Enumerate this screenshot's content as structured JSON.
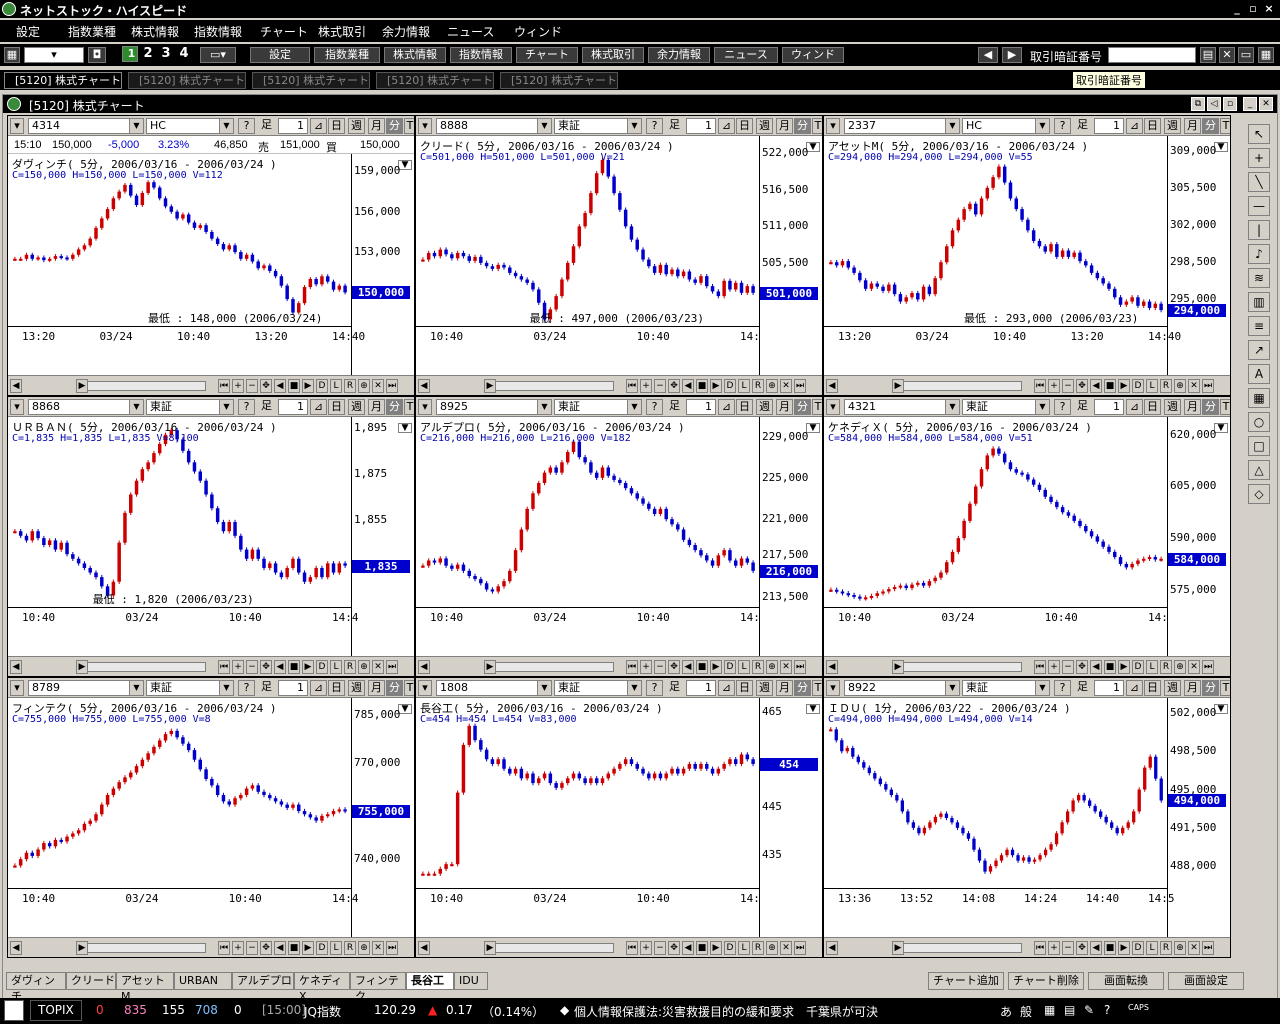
{
  "app": {
    "title": "ネットストック・ハイスピード",
    "win_controls": [
      "_",
      "▫",
      "×"
    ]
  },
  "menu": [
    "設定",
    "指数業種",
    "株式情報",
    "指数情報",
    "チャート",
    "株式取引",
    "余力情報",
    "ニュース",
    "ウィンド"
  ],
  "toolbar": {
    "layouts": [
      "1",
      "2",
      "3",
      "4"
    ],
    "buttons": [
      "設定",
      "指数業種",
      "株式情報",
      "指数情報",
      "チャート",
      "株式取引",
      "余力情報",
      "ニュース",
      "ウィンド"
    ],
    "pin_label": "取引暗証番号",
    "tooltip": "取引暗証番号"
  },
  "window_tabs": [
    "[5120] 株式チャート",
    "[5120] 株式チャート",
    "[5120] 株式チャート",
    "[5120] 株式チャート",
    "[5120] 株式チャート"
  ],
  "mdi_title": "[5120] 株式チャート",
  "interval_buttons": [
    "足",
    "日",
    "週",
    "月",
    "分",
    "T"
  ],
  "quote_row": {
    "time": "15:10",
    "price": "150,000",
    "change": "-5,000",
    "pct": "3.23%",
    "volume": "46,850",
    "sell_label": "売",
    "sell": "151,000",
    "buy_label": "買",
    "buy": "150,000"
  },
  "colors": {
    "up": "#cc0000",
    "down": "#0000cc",
    "tag": "#0000cc"
  },
  "panels": [
    {
      "code": "4314",
      "market": "HC",
      "title": "ダヴィンチ( 5分, 2006/03/16 - 2006/03/24 )",
      "ohlc": "C=150,000  H=150,000  L=150,000  V=112",
      "yticks": [
        "159,000",
        "156,000",
        "153,000"
      ],
      "ymin": 147500,
      "ymax": 160000,
      "tag": "150,000",
      "tag_value": 150000,
      "xticks": [
        "13:20",
        "03/24",
        "10:40",
        "13:20",
        "14:40"
      ],
      "low_label": "最低 : 148,000 (2006/03/24)",
      "series": [
        152500,
        152500,
        152800,
        152500,
        152600,
        152400,
        152500,
        152700,
        152600,
        152500,
        152800,
        153200,
        153500,
        154000,
        154800,
        155500,
        156200,
        157000,
        157500,
        158000,
        157200,
        156500,
        157400,
        158200,
        157800,
        157000,
        156400,
        156000,
        155500,
        155800,
        155200,
        154800,
        155000,
        154500,
        154000,
        153600,
        153200,
        153500,
        153000,
        152500,
        152800,
        152300,
        151800,
        152000,
        151600,
        151200,
        150500,
        149500,
        148500,
        149200,
        150400,
        151000,
        150600,
        151200,
        150800,
        150200,
        150500,
        150000
      ]
    },
    {
      "code": "8888",
      "market": "東証",
      "title": "クリード( 5分, 2006/03/16 - 2006/03/24 )",
      "ohlc": "C=501,000  H=501,000  L=501,000  V=21",
      "yticks": [
        "522,000",
        "516,500",
        "511,000",
        "505,500"
      ],
      "ymin": 496000,
      "ymax": 524000,
      "tag": "501,000",
      "tag_value": 501000,
      "xticks": [
        "10:40",
        "03/24",
        "10:40",
        "14:"
      ],
      "low_label": "最低 : 497,000 (2006/03/23)",
      "series": [
        506000,
        507000,
        506500,
        507500,
        506800,
        506200,
        507000,
        506500,
        505800,
        506400,
        505500,
        505000,
        504600,
        505200,
        504800,
        504000,
        503500,
        503000,
        502500,
        501500,
        499500,
        497000,
        498500,
        500500,
        503000,
        505500,
        508000,
        511000,
        513000,
        516000,
        519000,
        521000,
        518500,
        516000,
        513500,
        511000,
        509000,
        507500,
        506000,
        505000,
        504000,
        505200,
        503800,
        504500,
        503500,
        504200,
        503000,
        502500,
        503500,
        502000,
        501200,
        500500,
        502800,
        501500,
        502500,
        501000,
        502000,
        501000
      ]
    },
    {
      "code": "2337",
      "market": "HC",
      "title": "アセットM( 5分, 2006/03/16 - 2006/03/24 )",
      "ohlc": "C=294,000  H=294,000  L=294,000  V=55",
      "yticks": [
        "309,000",
        "305,500",
        "302,000",
        "298,500",
        "295,000"
      ],
      "ymin": 292500,
      "ymax": 310000,
      "tag": "294,000",
      "tag_value": 294000,
      "xticks": [
        "13:20",
        "03/24",
        "10:40",
        "13:20",
        "14:40"
      ],
      "low_label": "最低 : 293,000 (2006/03/23)",
      "series": [
        298500,
        298200,
        298600,
        298000,
        297500,
        296800,
        296000,
        296500,
        296200,
        295800,
        296400,
        295500,
        294800,
        295200,
        295600,
        295000,
        296200,
        295500,
        297000,
        298500,
        300000,
        301500,
        302500,
        303500,
        304000,
        303000,
        304500,
        305500,
        306500,
        307500,
        306000,
        304500,
        303500,
        302500,
        301500,
        300500,
        300000,
        299500,
        300200,
        299000,
        299600,
        299000,
        299400,
        298600,
        298200,
        297500,
        297000,
        296500,
        296000,
        295200,
        294500,
        294800,
        295200,
        294400,
        294800,
        294200,
        294600,
        294000
      ]
    },
    {
      "code": "8868",
      "market": "東証",
      "title": "ＵＲＢＡＮ( 5分, 2006/03/16 - 2006/03/24 )",
      "ohlc": "C=1,835  H=1,835  L=1,835  V=8,100",
      "yticks": [
        "1,895",
        "1,875",
        "1,855"
      ],
      "ymin": 1817,
      "ymax": 1898,
      "tag": "1,835",
      "tag_value": 1835,
      "xticks": [
        "10:40",
        "03/24",
        "10:40",
        "14:4"
      ],
      "low_label": "最低 : 1,820 (2006/03/23)",
      "series": [
        1850,
        1848,
        1846,
        1850,
        1847,
        1844,
        1846,
        1842,
        1845,
        1840,
        1838,
        1836,
        1834,
        1832,
        1830,
        1826,
        1822,
        1828,
        1845,
        1858,
        1866,
        1872,
        1877,
        1880,
        1884,
        1888,
        1892,
        1894,
        1890,
        1885,
        1880,
        1876,
        1872,
        1866,
        1860,
        1854,
        1850,
        1854,
        1848,
        1842,
        1838,
        1842,
        1838,
        1834,
        1836,
        1832,
        1830,
        1834,
        1838,
        1832,
        1828,
        1830,
        1834,
        1830,
        1836,
        1832,
        1836,
        1835
      ]
    },
    {
      "code": "8925",
      "market": "東証",
      "title": "アルデプロ( 5分, 2006/03/16 - 2006/03/24 )",
      "ohlc": "C=216,000  H=216,000  L=216,000  V=182",
      "yticks": [
        "229,000",
        "225,000",
        "221,000",
        "217,500",
        "213,500"
      ],
      "ymin": 212500,
      "ymax": 230500,
      "tag": "216,000",
      "tag_value": 216000,
      "xticks": [
        "10:40",
        "03/24",
        "10:40",
        "14:"
      ],
      "low_label": "",
      "series": [
        216500,
        217000,
        216800,
        217200,
        216500,
        216200,
        216600,
        216000,
        215500,
        215200,
        214800,
        214200,
        214000,
        214500,
        215000,
        216000,
        218000,
        220000,
        222000,
        223500,
        224500,
        225500,
        226000,
        225500,
        226500,
        227500,
        228500,
        227000,
        226500,
        225500,
        225000,
        226000,
        225200,
        224800,
        224500,
        224000,
        223500,
        223000,
        222500,
        222000,
        221500,
        222000,
        221000,
        220500,
        220000,
        219000,
        218500,
        218000,
        217500,
        217000,
        216500,
        217500,
        218000,
        217000,
        216500,
        217200,
        216800,
        216000
      ]
    },
    {
      "code": "4321",
      "market": "東証",
      "title": "ケネディＸ( 5分, 2006/03/16 - 2006/03/24 )",
      "ohlc": "C=584,000  H=584,000  L=584,000  V=51",
      "yticks": [
        "620,000",
        "605,000",
        "590,000",
        "575,000"
      ],
      "ymin": 570000,
      "ymax": 624000,
      "tag": "584,000",
      "tag_value": 584000,
      "xticks": [
        "10:40",
        "03/24",
        "10:40",
        "14:"
      ],
      "low_label": "",
      "series": [
        575000,
        574500,
        574000,
        573500,
        573000,
        572500,
        572800,
        573200,
        574000,
        574500,
        575200,
        575800,
        576200,
        575500,
        576500,
        577000,
        576200,
        577500,
        578500,
        580000,
        583000,
        586000,
        590000,
        595000,
        600000,
        605000,
        610000,
        614000,
        616000,
        614500,
        612000,
        610000,
        609000,
        608500,
        607000,
        605500,
        604000,
        602000,
        600500,
        599000,
        597500,
        596500,
        595000,
        593500,
        592000,
        590500,
        589000,
        587500,
        586000,
        584500,
        582500,
        581500,
        582500,
        583500,
        584000,
        584500,
        583800,
        584000
      ]
    },
    {
      "code": "8789",
      "market": "東証",
      "title": "フィンテク( 5分, 2006/03/16 - 2006/03/24 )",
      "ohlc": "C=755,000  H=755,000  L=755,000  V=8",
      "yticks": [
        "785,000",
        "770,000",
        "740,000"
      ],
      "ymin": 731000,
      "ymax": 789000,
      "tag": "755,000",
      "tag_value": 755000,
      "xticks": [
        "10:40",
        "03/24",
        "10:40",
        "14:4"
      ],
      "low_label": "",
      "series": [
        738000,
        740000,
        742000,
        741000,
        743000,
        745000,
        744000,
        746000,
        745500,
        747000,
        748000,
        749000,
        751000,
        752000,
        754000,
        757000,
        760000,
        762000,
        764000,
        765500,
        767000,
        769000,
        771000,
        773000,
        775000,
        777000,
        779000,
        780000,
        778000,
        776000,
        774000,
        771000,
        768000,
        765000,
        763000,
        760000,
        758000,
        757000,
        759000,
        760000,
        762000,
        763000,
        761000,
        760000,
        759000,
        758000,
        757000,
        756000,
        757000,
        755000,
        754000,
        753000,
        752000,
        753500,
        754000,
        755000,
        755500,
        755000
      ]
    },
    {
      "code": "1808",
      "market": "東証",
      "title": "長谷工( 5分, 2006/03/16 - 2006/03/24 )",
      "ohlc": "C=454  H=454  L=454  V=83,000",
      "yticks": [
        "465",
        "445",
        "435"
      ],
      "ymin": 428,
      "ymax": 467,
      "tag": "454",
      "tag_value": 454,
      "xticks": [
        "10:40",
        "03/24",
        "10:40",
        "14:"
      ],
      "low_label": "",
      "series": [
        431,
        431,
        431,
        432,
        433,
        433,
        448,
        458,
        462,
        459,
        457,
        455,
        454,
        455,
        453,
        452,
        453,
        451,
        452,
        450,
        451,
        452,
        450,
        449,
        450,
        451,
        452,
        451,
        450,
        451,
        450,
        451,
        452,
        453,
        454,
        455,
        454,
        453,
        452,
        451,
        452,
        451,
        452,
        453,
        452,
        453,
        454,
        453,
        454,
        453,
        452,
        453,
        454,
        455,
        454,
        456,
        455,
        454
      ]
    },
    {
      "code": "8922",
      "market": "東証",
      "title": "ＩＤＵ( 1分, 2006/03/22 - 2006/03/24 )",
      "ohlc": "C=494,000  H=494,000  L=494,000  V=14",
      "yticks": [
        "502,000",
        "498,500",
        "495,000",
        "491,500",
        "488,000"
      ],
      "ymin": 486000,
      "ymax": 503000,
      "tag": "494,000",
      "tag_value": 494000,
      "xticks": [
        "13:36",
        "13:52",
        "14:08",
        "14:24",
        "14:40",
        "14:5"
      ],
      "low_label": "",
      "series": [
        500500,
        499500,
        498500,
        498800,
        498000,
        497500,
        497000,
        496500,
        496000,
        495500,
        495000,
        494500,
        494000,
        493000,
        492000,
        491500,
        491000,
        491500,
        492000,
        492500,
        492800,
        492400,
        492000,
        491500,
        491000,
        490500,
        489500,
        488500,
        487500,
        488000,
        488500,
        489000,
        489500,
        489000,
        488500,
        488800,
        488400,
        488600,
        489000,
        489500,
        490000,
        491000,
        492000,
        493000,
        494000,
        494500,
        494000,
        493500,
        493000,
        492500,
        492000,
        491500,
        491000,
        491500,
        492000,
        493000,
        495000,
        497000,
        498000,
        496000,
        494000
      ]
    }
  ],
  "bottom_tabs": [
    "ダヴィンチ",
    "クリード",
    "アセットM",
    "URBAN",
    "アルデプロ",
    "ケネディX",
    "フィンテク",
    "長谷工",
    "IDU"
  ],
  "bottom_buttons": [
    "チャート追加",
    "チャート削除",
    "画面転換",
    "画面設定"
  ],
  "status": {
    "topix": "TOPIX",
    "v1": "0",
    "v2": "835",
    "v3": "155",
    "v4": "708",
    "v5": "0",
    "time": "[15:00]",
    "index_name": "JQ指数",
    "index_value": "120.29",
    "index_change": "0.17",
    "index_pct": "（0.14%）",
    "news": "個人情報保護法:災害救援目的の緩和要求　千葉県が可決",
    "ime": [
      "あ",
      "般"
    ]
  }
}
